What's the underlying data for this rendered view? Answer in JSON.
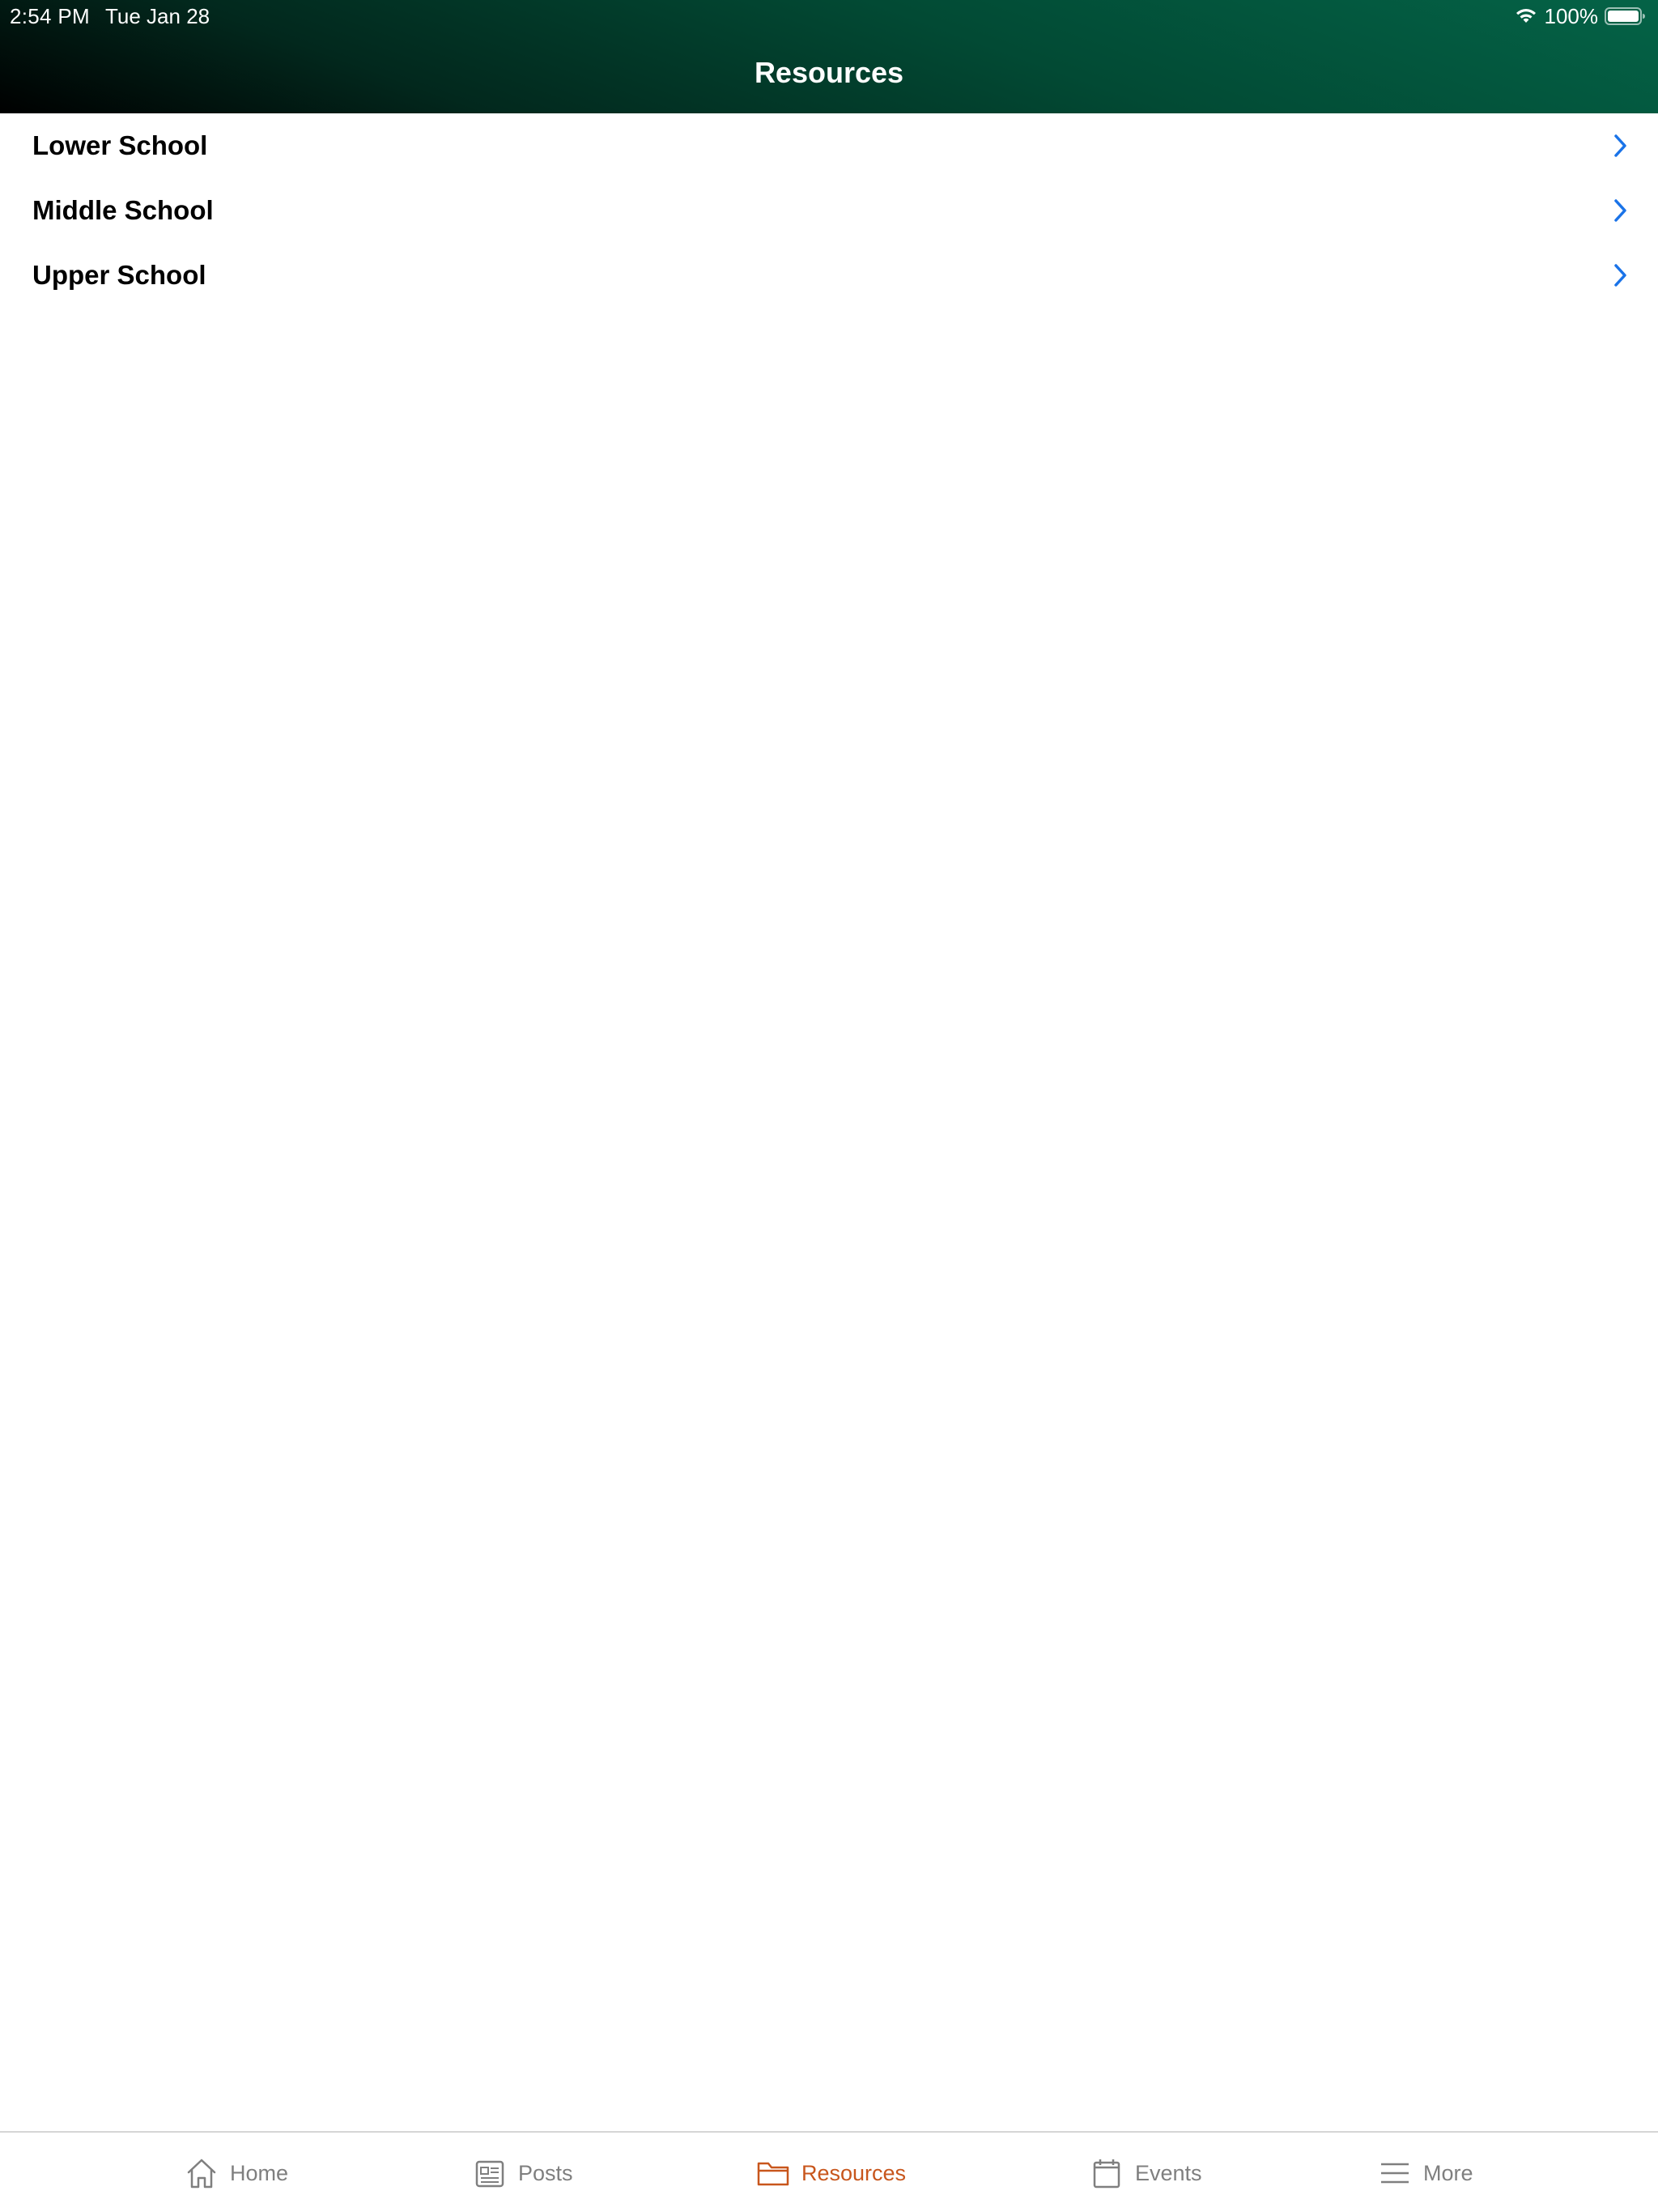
{
  "status_bar": {
    "time": "2:54 PM",
    "date": "Tue Jan 28",
    "battery_percent": "100%",
    "wifi_icon": "wifi-icon",
    "battery_icon": "battery-icon"
  },
  "header": {
    "title": "Resources",
    "gradient_colors": [
      "#000000",
      "#046347"
    ]
  },
  "list": {
    "items": [
      {
        "label": "Lower School",
        "icon": "chevron-right-icon"
      },
      {
        "label": "Middle School",
        "icon": "chevron-right-icon"
      },
      {
        "label": "Upper School",
        "icon": "chevron-right-icon"
      }
    ],
    "chevron_color": "#1a73e8"
  },
  "tabbar": {
    "active_color": "#c8561c",
    "inactive_color": "#7f7f7f",
    "tabs": [
      {
        "label": "Home",
        "icon": "home-icon",
        "active": false
      },
      {
        "label": "Posts",
        "icon": "newspaper-icon",
        "active": false
      },
      {
        "label": "Resources",
        "icon": "folder-icon",
        "active": true
      },
      {
        "label": "Events",
        "icon": "calendar-icon",
        "active": false
      },
      {
        "label": "More",
        "icon": "menu-icon",
        "active": false
      }
    ]
  }
}
